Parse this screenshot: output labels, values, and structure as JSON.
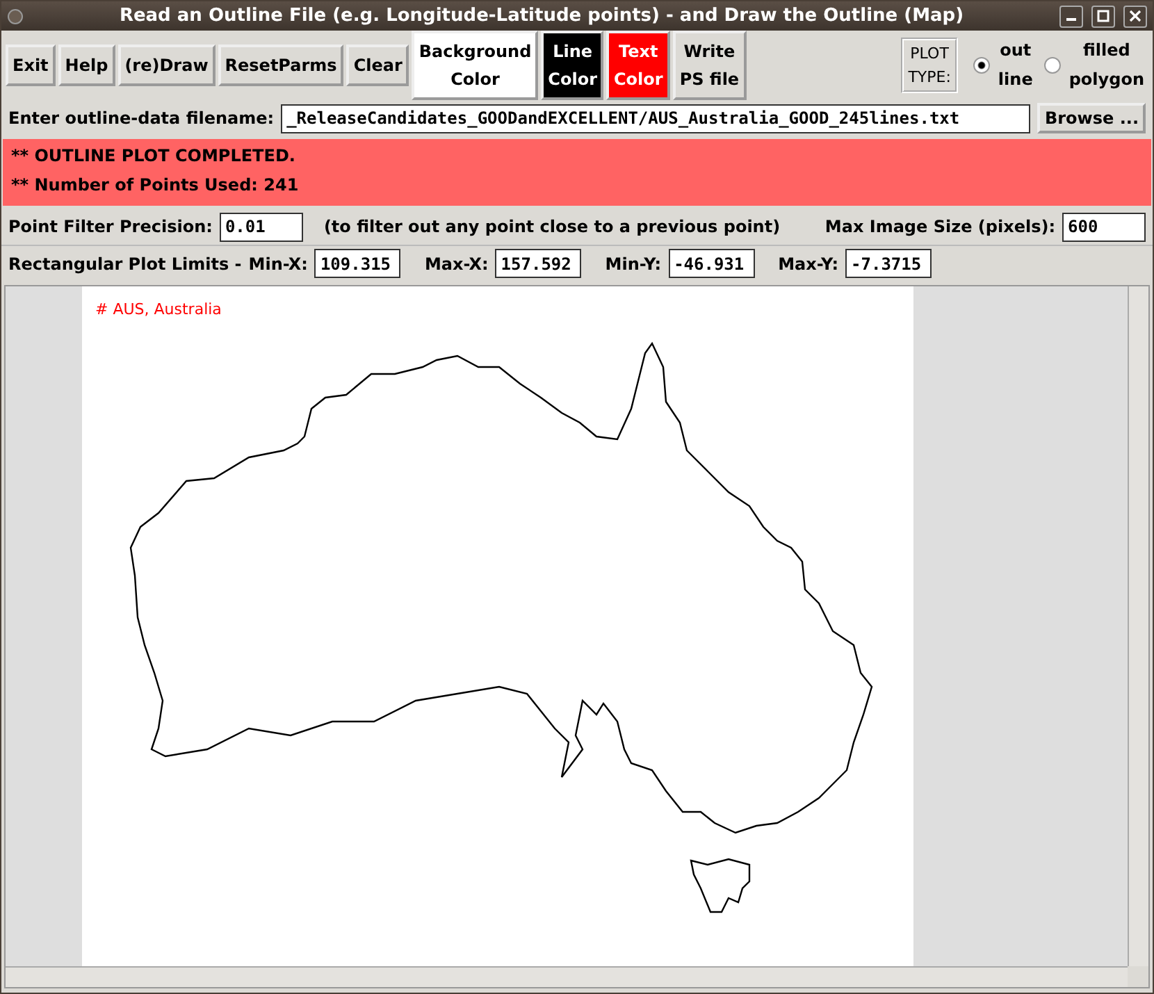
{
  "window": {
    "title": "Read an Outline File (e.g. Longitude-Latitude points) - and Draw the Outline (Map)"
  },
  "toolbar": {
    "buttons": [
      {
        "label": "Exit",
        "kind": "plain"
      },
      {
        "label": "Help",
        "kind": "plain"
      },
      {
        "label": "(re)Draw",
        "kind": "plain"
      },
      {
        "label": "ResetParms",
        "kind": "plain"
      },
      {
        "label": "Clear",
        "kind": "plain"
      },
      {
        "label": "Background\nColor",
        "kind": "swatch",
        "color": "#ffffff"
      },
      {
        "label": "Line\nColor",
        "kind": "swatch",
        "color": "#000000"
      },
      {
        "label": "Text\nColor",
        "kind": "swatch",
        "color": "#ff0000"
      },
      {
        "label": "Write\nPS file",
        "kind": "plain"
      }
    ],
    "plot_type": {
      "label": "PLOT\nTYPE:",
      "options": [
        {
          "label": "out\nline",
          "selected": true
        },
        {
          "label": "filled\npolygon",
          "selected": false
        }
      ]
    }
  },
  "file_row": {
    "label": "Enter outline-data filename:",
    "value": "_ReleaseCandidates_GOODandEXCELLENT/AUS_Australia_GOOD_245lines.txt",
    "button": "Browse ..."
  },
  "status": {
    "lines": [
      "** OUTLINE PLOT COMPLETED.",
      "** Number of Points Used: 241"
    ]
  },
  "filter_row": {
    "label": "Point Filter Precision:",
    "value": "0.01",
    "note": "(to filter out any point close to a previous point)",
    "size_label": "Max Image Size (pixels):",
    "size_value": "600"
  },
  "limits_row": {
    "label": "Rectangular Plot Limits -",
    "fields": [
      {
        "label": "Min-X:",
        "value": "109.315"
      },
      {
        "label": "Max-X:",
        "value": "157.592"
      },
      {
        "label": "Min-Y:",
        "value": "-46.931"
      },
      {
        "label": "Max-Y:",
        "value": "-7.3715"
      }
    ]
  },
  "canvas": {
    "caption": "# AUS, Australia"
  }
}
